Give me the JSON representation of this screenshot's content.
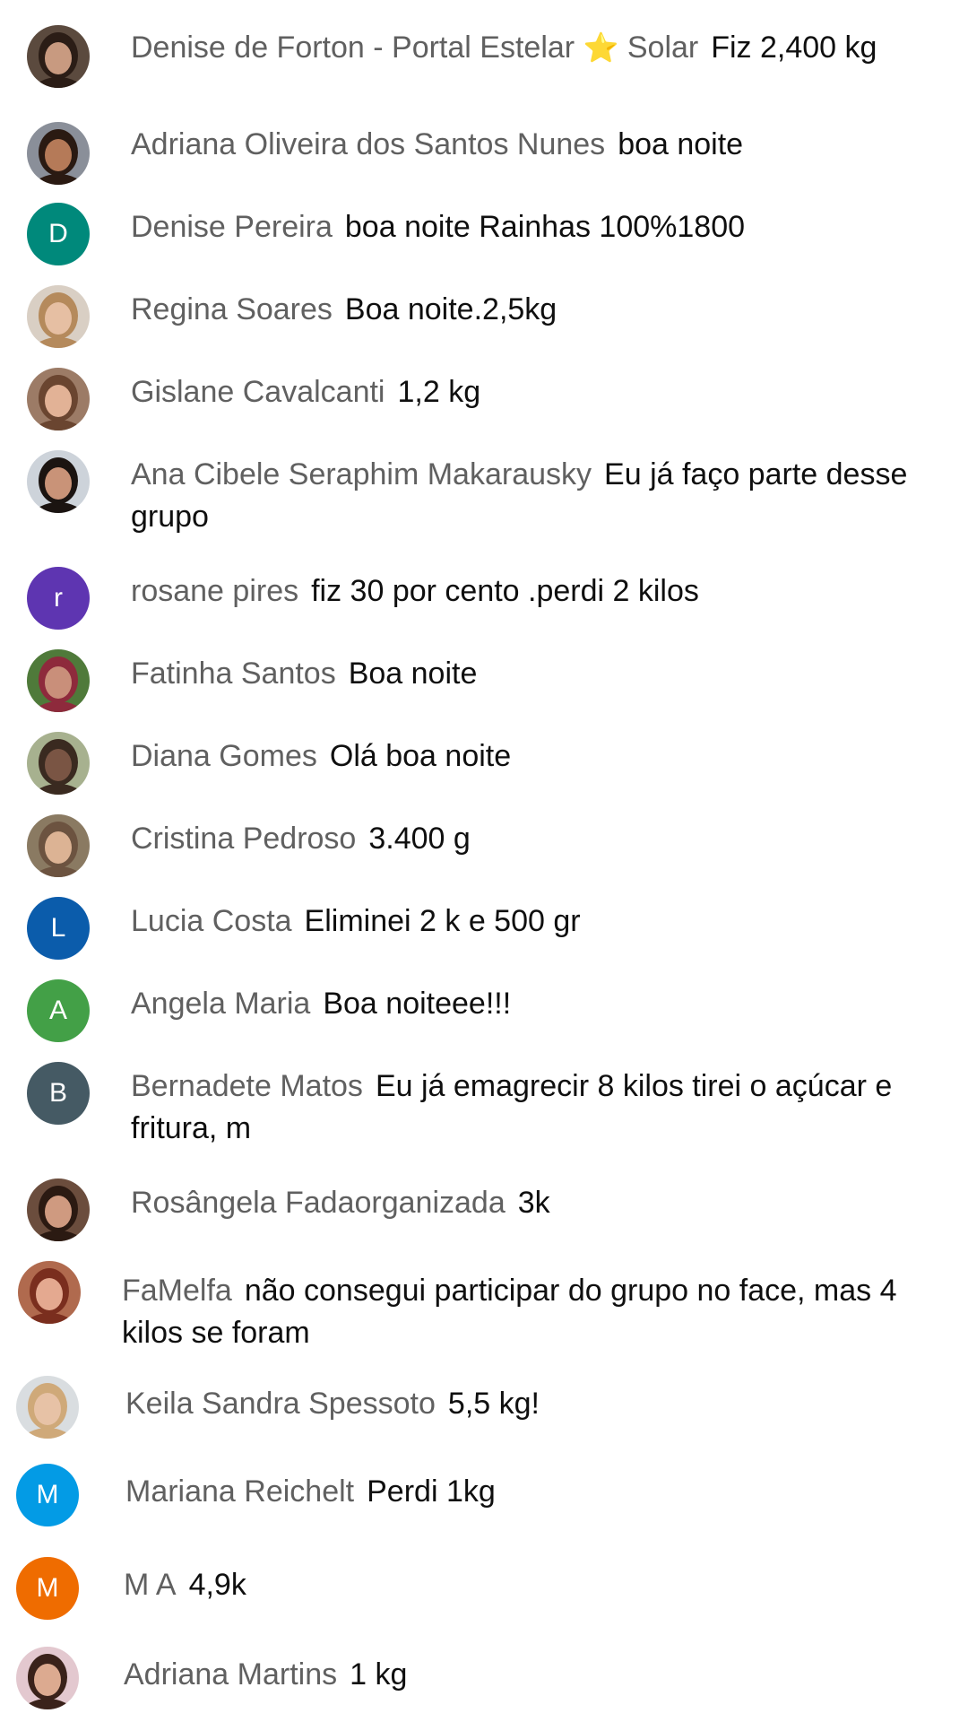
{
  "messages": [
    {
      "author": "Denise de Forton - Portal Estelar",
      "badge": "⭐",
      "author_suffix": "Solar",
      "text": "Fiz 2,400 kg",
      "avatar": {
        "type": "photo",
        "bg": "#5b4a3e",
        "skin": "#c89a80",
        "hair": "#2b1d16"
      }
    },
    {
      "author": "Adriana Oliveira dos Santos Nunes",
      "text": "boa noite",
      "avatar": {
        "type": "photo",
        "bg": "#8a8f99",
        "skin": "#b57a58",
        "hair": "#2a1a12"
      }
    },
    {
      "author": "Denise Pereira",
      "text": "boa noite Rainhas 100%1800",
      "avatar": {
        "type": "letter",
        "letter": "D",
        "color": "#00897b"
      }
    },
    {
      "author": "Regina Soares",
      "text": "Boa noite.2,5kg",
      "avatar": {
        "type": "photo",
        "bg": "#d9cfc4",
        "skin": "#e6bfa3",
        "hair": "#b58a5c"
      }
    },
    {
      "author": "Gislane Cavalcanti",
      "text": "1,2 kg",
      "avatar": {
        "type": "photo",
        "bg": "#9c7b66",
        "skin": "#e2b296",
        "hair": "#6a4530"
      }
    },
    {
      "author": "Ana Cibele Seraphim Makarausky",
      "text": "Eu já faço parte desse grupo",
      "avatar": {
        "type": "photo",
        "bg": "#cdd3da",
        "skin": "#c99378",
        "hair": "#1b1411"
      }
    },
    {
      "author": "rosane pires",
      "text": "fiz 30 por cento .perdi 2 kilos",
      "avatar": {
        "type": "letter",
        "letter": "r",
        "color": "#5e35b1"
      }
    },
    {
      "author": "Fatinha Santos",
      "text": "Boa noite",
      "avatar": {
        "type": "photo",
        "bg": "#4f7a3a",
        "skin": "#c98f7a",
        "hair": "#8e2a3c"
      }
    },
    {
      "author": "Diana Gomes",
      "text": "Olá boa noite",
      "avatar": {
        "type": "photo",
        "bg": "#a7b18f",
        "skin": "#7a5544",
        "hair": "#3a2a20"
      }
    },
    {
      "author": "Cristina Pedroso",
      "text": "3.400 g",
      "avatar": {
        "type": "photo",
        "bg": "#8a7a62",
        "skin": "#dcb394",
        "hair": "#6c5340"
      }
    },
    {
      "author": "Lucia Costa",
      "text": "Eliminei 2 k e 500 gr",
      "avatar": {
        "type": "letter",
        "letter": "L",
        "color": "#0b5cab"
      }
    },
    {
      "author": "Angela Maria",
      "text": "Boa noiteee!!!",
      "avatar": {
        "type": "letter",
        "letter": "A",
        "color": "#43a047"
      }
    },
    {
      "author": "Bernadete Matos",
      "text": "Eu já emagrecir 8 kilos tirei o açúcar e fritura, m",
      "avatar": {
        "type": "letter",
        "letter": "B",
        "color": "#455a64"
      }
    },
    {
      "author": "Rosângela Fadaorganizada",
      "text": "3k",
      "avatar": {
        "type": "photo",
        "bg": "#6b4d3d",
        "skin": "#cf9a80",
        "hair": "#2b1a12"
      }
    },
    {
      "author": "FaMelfa",
      "text": "não consegui participar do grupo no face, mas 4 kilos se foram",
      "avatar": {
        "type": "photo",
        "bg": "#b06a4e",
        "skin": "#e4a990",
        "hair": "#7a2e1e"
      }
    },
    {
      "author": "Keila Sandra Spessoto",
      "text": "5,5 kg!",
      "avatar": {
        "type": "photo",
        "bg": "#d9dde0",
        "skin": "#e7c2a6",
        "hair": "#cfa979"
      }
    },
    {
      "author": "Mariana Reichelt",
      "text": "Perdi 1kg",
      "avatar": {
        "type": "letter",
        "letter": "M",
        "color": "#039be5"
      }
    },
    {
      "author": "M A",
      "text": "4,9k",
      "avatar": {
        "type": "letter",
        "letter": "M",
        "color": "#ef6c00"
      }
    },
    {
      "author": "Adriana Martins",
      "text": "1 kg",
      "avatar": {
        "type": "photo",
        "bg": "#e3c8cf",
        "skin": "#dcaa90",
        "hair": "#3a221a"
      }
    }
  ]
}
